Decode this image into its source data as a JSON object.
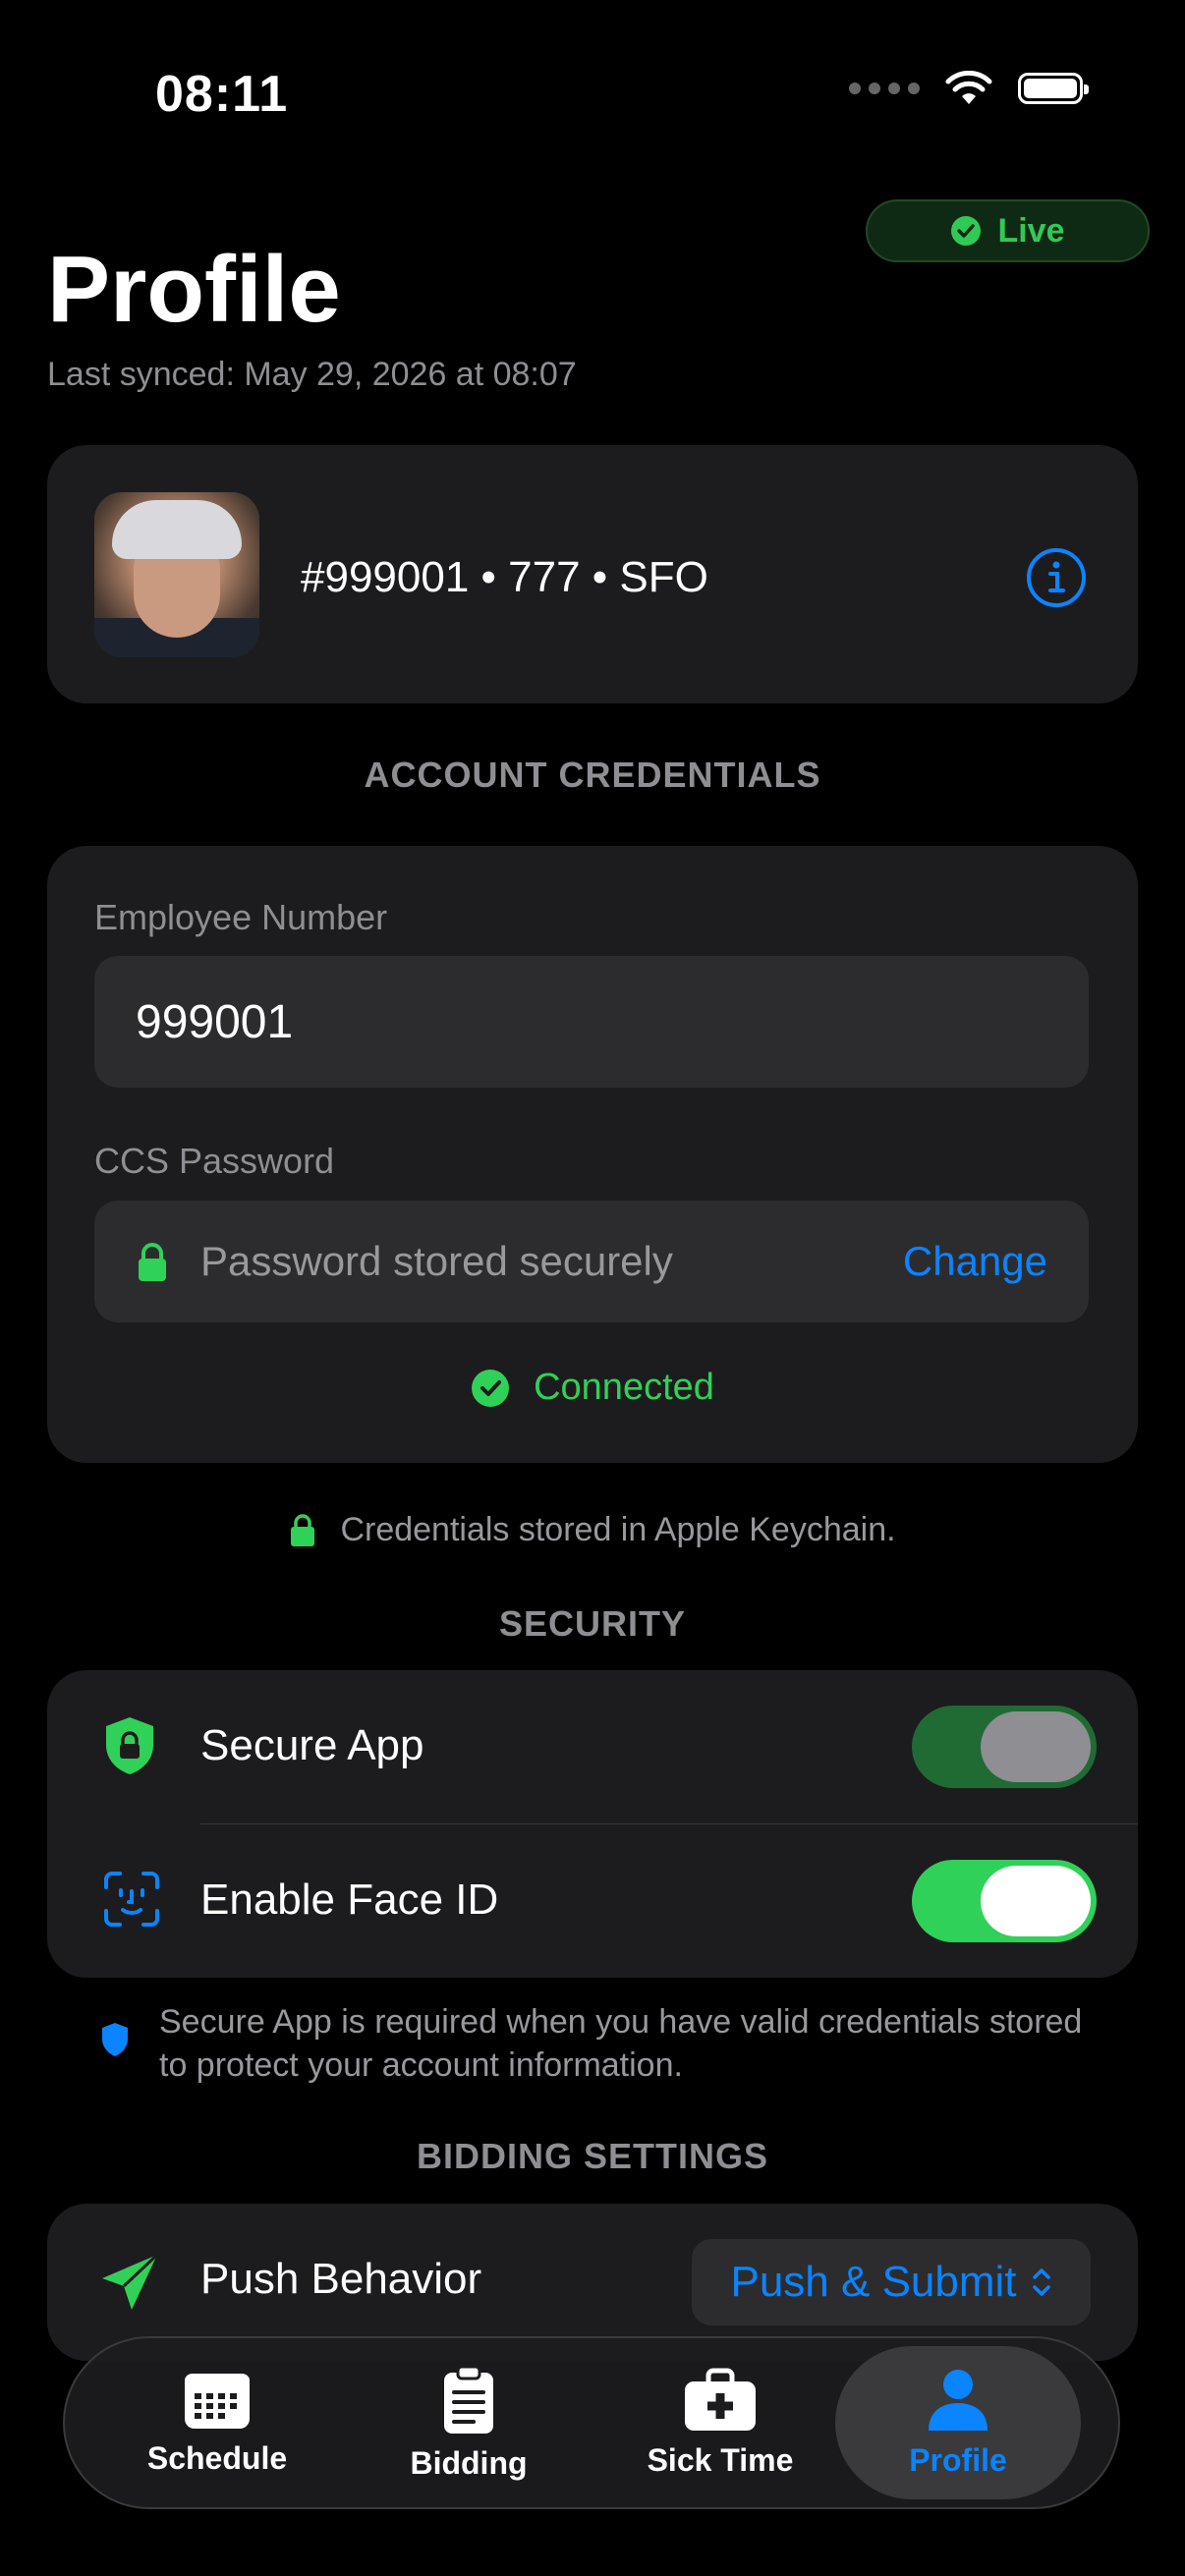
{
  "status_bar": {
    "time": "08:11"
  },
  "header": {
    "title": "Profile",
    "last_synced": "Last synced: May 29, 2026 at 08:07",
    "live_label": "Live"
  },
  "profile": {
    "summary": "#999001 • 777 • SFO"
  },
  "credentials": {
    "section_title": "ACCOUNT CREDENTIALS",
    "employee_label": "Employee Number",
    "employee_value": "999001",
    "password_label": "CCS Password",
    "password_status": "Password stored securely",
    "change_label": "Change",
    "connected_label": "Connected",
    "keychain_note": "Credentials stored in Apple Keychain."
  },
  "security": {
    "section_title": "SECURITY",
    "secure_app_label": "Secure App",
    "secure_app_on": true,
    "face_id_label": "Enable Face ID",
    "face_id_on": true,
    "note": "Secure App is required when you have valid credentials stored to protect your account information."
  },
  "bidding": {
    "section_title": "BIDDING SETTINGS",
    "push_label": "Push Behavior",
    "push_value": "Push & Submit"
  },
  "tabs": [
    {
      "label": "Schedule"
    },
    {
      "label": "Bidding"
    },
    {
      "label": "Sick Time"
    },
    {
      "label": "Profile"
    }
  ],
  "colors": {
    "accent": "#0a84ff",
    "success": "#30d158",
    "card": "#1c1c1e"
  }
}
